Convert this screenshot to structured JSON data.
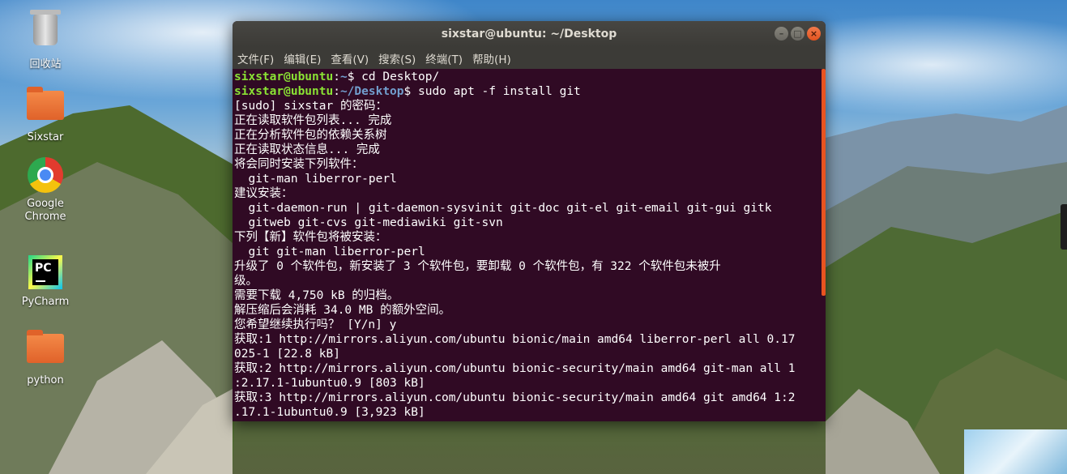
{
  "desktop": {
    "icons": [
      {
        "id": "trash",
        "label": "回收站"
      },
      {
        "id": "sixstar",
        "label": "Sixstar"
      },
      {
        "id": "chrome",
        "label": "Google Chrome"
      },
      {
        "id": "pycharm",
        "label": "PyCharm",
        "badge": "PC"
      },
      {
        "id": "python",
        "label": "python"
      }
    ]
  },
  "window": {
    "title": "sixstar@ubuntu: ~/Desktop",
    "buttons": {
      "minimize": "–",
      "maximize": "□",
      "close": "×"
    },
    "menu": [
      "文件(F)",
      "编辑(E)",
      "查看(V)",
      "搜索(S)",
      "终端(T)",
      "帮助(H)"
    ]
  },
  "terminal": {
    "prompt1": {
      "user": "sixstar@ubuntu",
      "path": "~",
      "cmd": "$ cd Desktop/"
    },
    "prompt2": {
      "user": "sixstar@ubuntu",
      "path": "~/Desktop",
      "cmd": "$ sudo apt -f install git"
    },
    "lines": [
      "[sudo] sixstar 的密码：",
      "正在读取软件包列表... 完成",
      "正在分析软件包的依赖关系树",
      "正在读取状态信息... 完成",
      "将会同时安装下列软件：",
      "  git-man liberror-perl",
      "建议安装：",
      "  git-daemon-run | git-daemon-sysvinit git-doc git-el git-email git-gui gitk",
      "  gitweb git-cvs git-mediawiki git-svn",
      "下列【新】软件包将被安装：",
      "  git git-man liberror-perl",
      "升级了 0 个软件包，新安装了 3 个软件包，要卸载 0 个软件包，有 322 个软件包未被升",
      "级。",
      "需要下载 4,750 kB 的归档。",
      "解压缩后会消耗 34.0 MB 的额外空间。",
      "您希望继续执行吗？ [Y/n] y",
      "获取:1 http://mirrors.aliyun.com/ubuntu bionic/main amd64 liberror-perl all 0.17",
      "025-1 [22.8 kB]",
      "获取:2 http://mirrors.aliyun.com/ubuntu bionic-security/main amd64 git-man all 1",
      ":2.17.1-1ubuntu0.9 [803 kB]",
      "获取:3 http://mirrors.aliyun.com/ubuntu bionic-security/main amd64 git amd64 1:2",
      ".17.1-1ubuntu0.9 [3,923 kB]"
    ]
  },
  "colors": {
    "terminal_bg": "#300a24",
    "prompt_user": "#8ae234",
    "prompt_path": "#729fcf",
    "accent": "#e95420",
    "titlebar": "#3c3b37"
  }
}
